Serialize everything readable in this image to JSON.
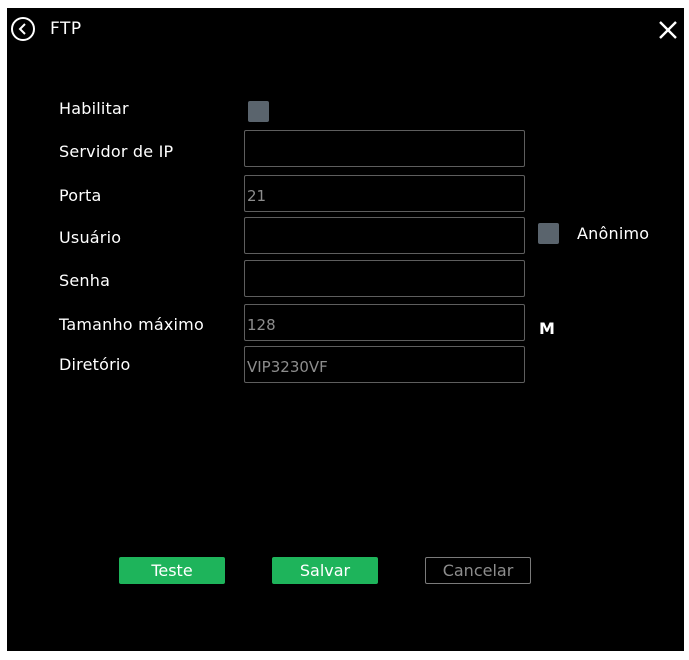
{
  "dialog": {
    "title": "FTP"
  },
  "form": {
    "habilitar_label": "Habilitar",
    "habilitar_checked": false,
    "servidor_label": "Servidor de IP",
    "servidor_value": "",
    "porta_label": "Porta",
    "porta_value": "21",
    "usuario_label": "Usuário",
    "usuario_value": "",
    "anonimo_label": "Anônimo",
    "anonimo_checked": false,
    "senha_label": "Senha",
    "senha_value": "",
    "tamanho_label": "Tamanho máximo",
    "tamanho_value": "128",
    "tamanho_unit": "M",
    "diretorio_label": "Diretório",
    "diretorio_value": "VIP3230VF"
  },
  "buttons": {
    "teste": "Teste",
    "salvar": "Salvar",
    "cancelar": "Cancelar"
  },
  "colors": {
    "background": "#000000",
    "primary_button": "#1eb45b",
    "checkbox": "#5a646d",
    "field_border": "#5e5e5e"
  },
  "icons": {
    "back": "chevron-left-circle-icon",
    "close": "close-icon"
  }
}
